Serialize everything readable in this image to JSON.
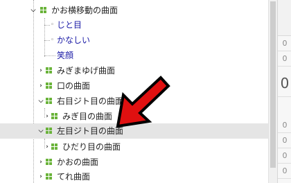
{
  "tree": {
    "items": [
      {
        "label": "かお横移動の曲面",
        "expanded": true,
        "selected": false
      },
      {
        "label": "じと目",
        "kind": "leaf"
      },
      {
        "label": "かなしい",
        "kind": "leaf"
      },
      {
        "label": "笑顔",
        "kind": "leaf"
      },
      {
        "label": "みぎまゆげ曲面",
        "expanded": false
      },
      {
        "label": "口の曲面",
        "expanded": false
      },
      {
        "label": "右目ジト目の曲面",
        "expanded": true
      },
      {
        "label": "みぎ目の曲面",
        "expanded": false
      },
      {
        "label": "左目ジト目の曲面",
        "expanded": true,
        "selected": true
      },
      {
        "label": "ひだり目の曲面",
        "expanded": false
      },
      {
        "label": "かおの曲面",
        "expanded": false
      },
      {
        "label": "てれ曲面",
        "expanded": false
      }
    ],
    "leaf_icons": [
      "circle-dots-icon",
      "circle-dots-icon",
      "dash-icon"
    ]
  },
  "right_panel": {
    "cells": [
      "0",
      "0",
      "0",
      "0",
      "0",
      "0"
    ],
    "big_symbol": "0"
  },
  "colors": {
    "accent_green": "#6ab33a",
    "link_blue": "#1a1aa6",
    "selected_row": "#e5e5e5",
    "arrow_red": "#e01010"
  }
}
